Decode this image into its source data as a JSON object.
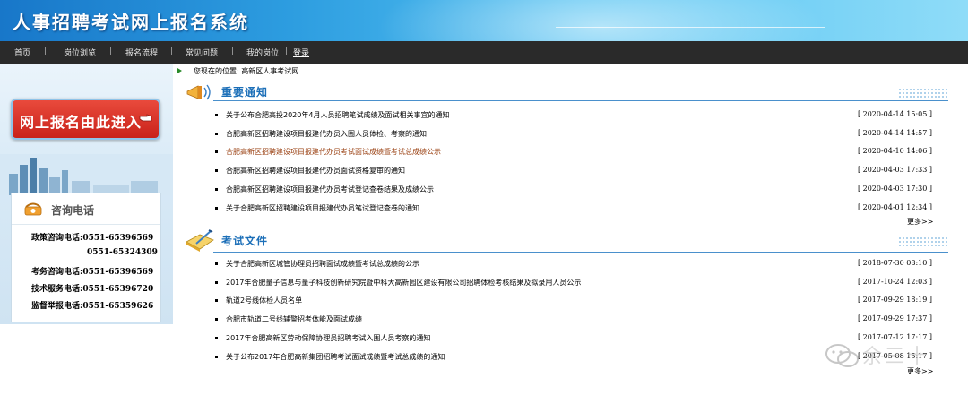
{
  "header": {
    "title": "人事招聘考试网上报名系统"
  },
  "nav": {
    "items": [
      "首页",
      "岗位浏览",
      "报名流程",
      "常见问题",
      "我的岗位",
      "登录"
    ]
  },
  "left": {
    "signup_button": "网上报名由此进入",
    "consult_title": "咨询电话",
    "lines": [
      "政策咨询电话:0551-65396569",
      "0551-65324309",
      "考务咨询电话:0551-65396569",
      "技术服务电话:0551-65396720",
      "监督举报电话:0551-65359626"
    ]
  },
  "breadcrumb": "您现在的位置: 高新区人事考试网",
  "sections": [
    {
      "title": "重要通知",
      "items": [
        {
          "title": "关于公布合肥高投2020年4月人员招聘笔试成绩及面试相关事宜的通知",
          "date": "[ 2020-04-14 15:05 ]"
        },
        {
          "title": "合肥高新区招聘建设项目报建代办员入围人员体检、考察的通知",
          "date": "[ 2020-04-14 14:57 ]"
        },
        {
          "title": "合肥高新区招聘建设项目报建代办员考试面试成绩暨考试总成绩公示",
          "date": "[ 2020-04-10 14:06 ]"
        },
        {
          "title": "合肥高新区招聘建设项目报建代办员面试资格复审的通知",
          "date": "[ 2020-04-03 17:33 ]"
        },
        {
          "title": "合肥高新区招聘建设项目报建代办员考试登记查卷结果及成绩公示",
          "date": "[ 2020-04-03 17:30 ]"
        },
        {
          "title": "关于合肥高新区招聘建设项目报建代办员笔试登记查卷的通知",
          "date": "[ 2020-04-01 12:34 ]"
        }
      ],
      "more": "更多>>"
    },
    {
      "title": "考试文件",
      "items": [
        {
          "title": "关于合肥高新区城管协理员招聘面试成绩暨考试总成绩的公示",
          "date": "[ 2018-07-30 08:10 ]"
        },
        {
          "title": "2017年合肥量子信息与量子科技创新研究院暨中科大高新园区建设有限公司招聘体检考核结果及拟录用人员公示",
          "date": "[ 2017-10-24 12:03 ]"
        },
        {
          "title": "轨道2号线体检人员名单",
          "date": "[ 2017-09-29 18:19 ]"
        },
        {
          "title": "合肥市轨道二号线辅警招考体能及面试成绩",
          "date": "[ 2017-09-29 17:37 ]"
        },
        {
          "title": "2017年合肥高新区劳动保障协理员招聘考试入围人员考察的通知",
          "date": "[ 2017-07-12 17:17 ]"
        },
        {
          "title": "关于公布2017年合肥高新集团招聘考试面试成绩暨考试总成绩的通知",
          "date": "[ 2017-05-08 15:17 ]"
        }
      ],
      "more": "更多>>"
    }
  ],
  "watermark": "余三十",
  "colors": {
    "nav_bg": "#2a2a2a",
    "accent": "#1c6fb8",
    "highlight_link": "#9a4012",
    "signup_red": "#d12a20"
  },
  "icons": {
    "section1": "megaphone-icon",
    "section2": "pen-paper-icon",
    "phone": "phone-icon",
    "hand": "pointing-hand-icon"
  }
}
